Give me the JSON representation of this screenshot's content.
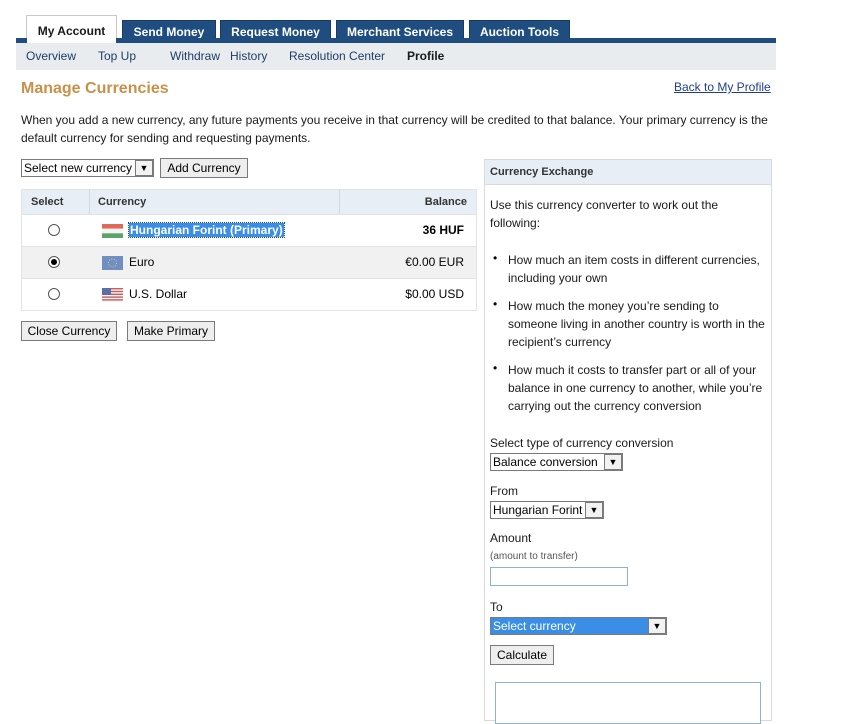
{
  "tabs": [
    {
      "label": "My Account"
    },
    {
      "label": "Send Money"
    },
    {
      "label": "Request Money"
    },
    {
      "label": "Merchant Services"
    },
    {
      "label": "Auction Tools"
    }
  ],
  "subnav": [
    {
      "label": "Overview"
    },
    {
      "label": "Top Up"
    },
    {
      "label": "Withdraw"
    },
    {
      "label": "History"
    },
    {
      "label": "Resolution Center"
    },
    {
      "label": "Profile"
    }
  ],
  "page": {
    "title": "Manage Currencies",
    "back_link": "Back to My Profile",
    "intro": "When you add a new currency, any future payments you receive in that currency will be credited to that balance. Your primary currency is the default currency for sending and requesting payments."
  },
  "add_currency": {
    "select_value": "Select new currency",
    "button": "Add Currency"
  },
  "table": {
    "headers": {
      "select": "Select",
      "currency": "Currency",
      "balance": "Balance"
    },
    "rows": [
      {
        "name": "Hungarian Forint (Primary)",
        "balance": "36 HUF",
        "selected": false,
        "flag": "hungary-flag"
      },
      {
        "name": "Euro",
        "balance": "€0.00 EUR",
        "selected": true,
        "flag": "eu-flag"
      },
      {
        "name": "U.S. Dollar",
        "balance": "$0.00 USD",
        "selected": false,
        "flag": "us-flag"
      }
    ]
  },
  "actions": {
    "close": "Close Currency",
    "primary": "Make Primary"
  },
  "exchange": {
    "title": "Currency Exchange",
    "intro": "Use this currency converter to work out the following:",
    "bullets": [
      "How much an item costs in different currencies, including your own",
      "How much the money you’re sending to someone living in another country is worth in the recipient’s currency",
      "How much it costs to transfer part or all of your balance in one currency to another, while you’re carrying out the currency conversion"
    ],
    "type_label": "Select type of currency conversion",
    "type_value": "Balance conversion",
    "from_label": "From",
    "from_value": "Hungarian Forint",
    "amount_label": "Amount",
    "amount_hint": "(amount to transfer)",
    "amount_value": "",
    "to_label": "To",
    "to_value": "Select currency",
    "calculate": "Calculate"
  },
  "colors": {
    "tab_bg": "#1f4d80",
    "title": "#c7914a",
    "link": "#1f3d96",
    "highlight": "#3a8ee6"
  }
}
